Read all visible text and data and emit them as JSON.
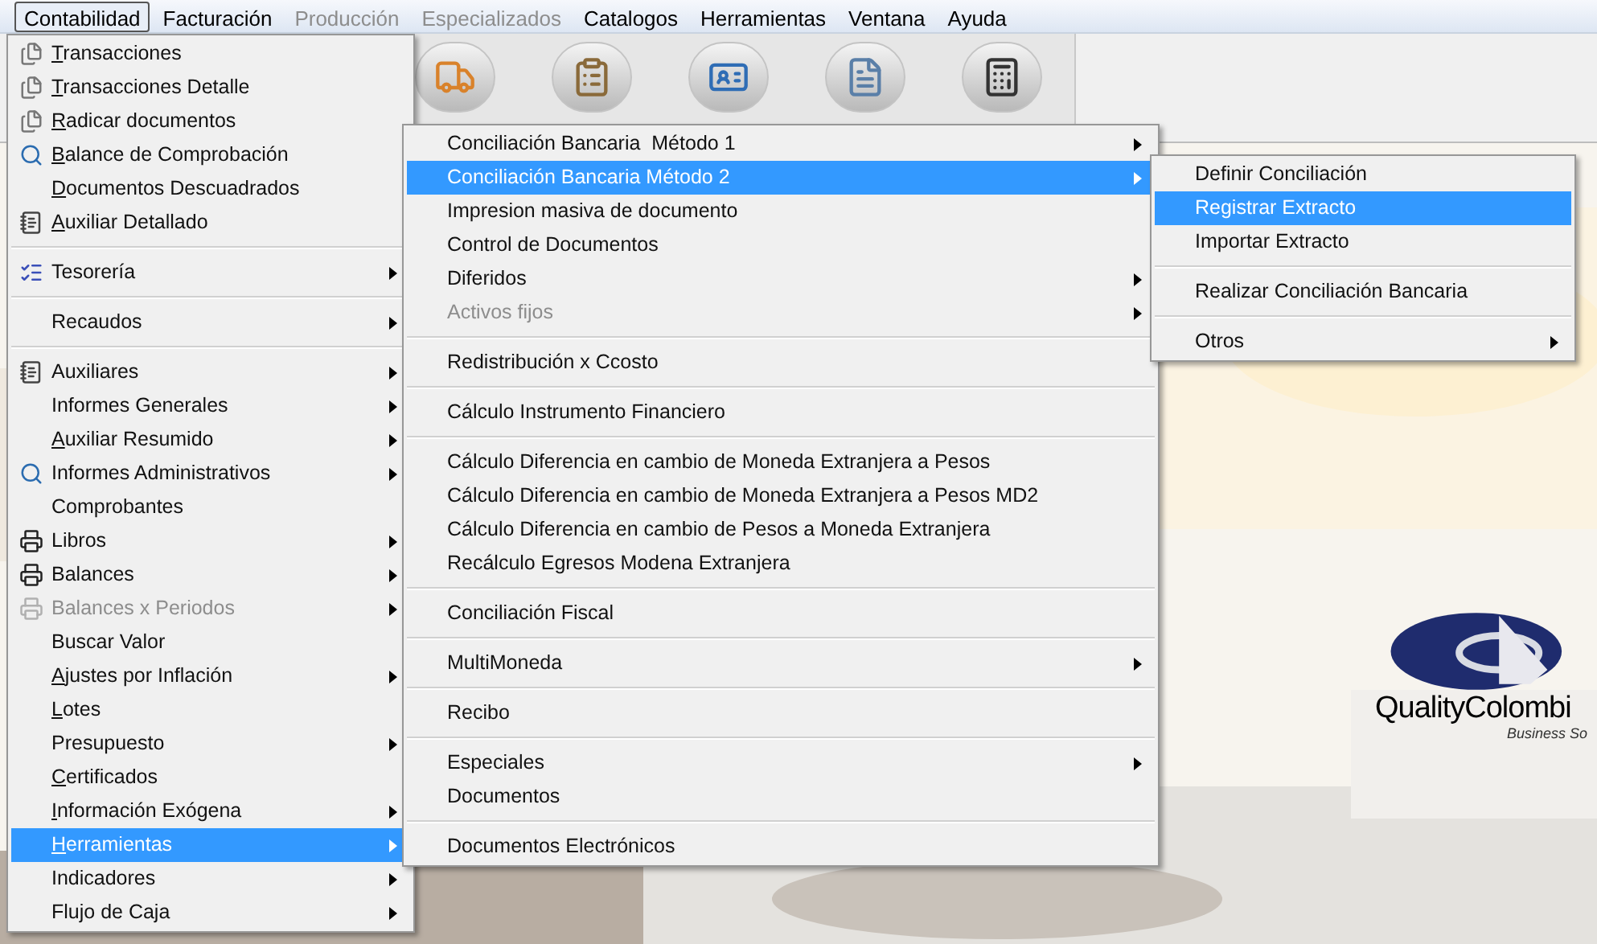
{
  "menubar": [
    {
      "label": "Contabilidad",
      "selected": true,
      "disabled": false
    },
    {
      "label": "Facturación",
      "selected": false,
      "disabled": false
    },
    {
      "label": "Producción",
      "selected": false,
      "disabled": true
    },
    {
      "label": "Especializados",
      "selected": false,
      "disabled": true
    },
    {
      "label": "Catalogos",
      "selected": false,
      "disabled": false
    },
    {
      "label": "Herramientas",
      "selected": false,
      "disabled": false
    },
    {
      "label": "Ventana",
      "selected": false,
      "disabled": false
    },
    {
      "label": "Ayuda",
      "selected": false,
      "disabled": false
    }
  ],
  "toolbar": {
    "buttons": [
      {
        "kind": "truck"
      },
      {
        "kind": "clipboard"
      },
      {
        "kind": "card"
      },
      {
        "kind": "document"
      },
      {
        "kind": "calculator"
      }
    ]
  },
  "contabilidad_menu": {
    "groups": [
      [
        {
          "label": "Transacciones",
          "kind": "ledger",
          "mnemonic": true,
          "submenu": false,
          "disabled": false,
          "selected": false
        },
        {
          "label": "Transacciones Detalle",
          "kind": "ledger",
          "mnemonic": true,
          "submenu": false,
          "disabled": false,
          "selected": false
        },
        {
          "label": "Radicar documentos",
          "kind": "ledger",
          "mnemonic": true,
          "submenu": false,
          "disabled": false,
          "selected": false
        },
        {
          "label": "Balance de Comprobación",
          "kind": "magnifier",
          "mnemonic": true,
          "submenu": false,
          "disabled": false,
          "selected": false
        },
        {
          "label": "Documentos Descuadrados",
          "mnemonic": true,
          "submenu": false,
          "disabled": false,
          "selected": false
        },
        {
          "label": "Auxiliar Detallado",
          "kind": "notebook",
          "mnemonic": true,
          "submenu": false,
          "disabled": false,
          "selected": false
        }
      ],
      [
        {
          "label": "Tesorería",
          "kind": "checklist",
          "mnemonic": false,
          "submenu": true,
          "disabled": false,
          "selected": false
        }
      ],
      [
        {
          "label": "Recaudos",
          "mnemonic": false,
          "submenu": true,
          "disabled": false,
          "selected": false
        }
      ],
      [
        {
          "label": "Auxiliares",
          "kind": "notebook",
          "mnemonic": false,
          "submenu": true,
          "disabled": false,
          "selected": false
        },
        {
          "label": "Informes Generales",
          "mnemonic": false,
          "submenu": true,
          "disabled": false,
          "selected": false
        },
        {
          "label": "Auxiliar Resumido",
          "mnemonic": true,
          "submenu": true,
          "disabled": false,
          "selected": false
        },
        {
          "label": "Informes Administrativos",
          "kind": "magnifier",
          "mnemonic": false,
          "submenu": true,
          "disabled": false,
          "selected": false
        },
        {
          "label": "Comprobantes",
          "mnemonic": false,
          "submenu": false,
          "disabled": false,
          "selected": false
        },
        {
          "label": "Libros",
          "kind": "printer",
          "mnemonic": false,
          "submenu": true,
          "disabled": false,
          "selected": false
        },
        {
          "label": "Balances",
          "kind": "printer",
          "mnemonic": false,
          "submenu": true,
          "disabled": false,
          "selected": false
        },
        {
          "label": "Balances x Periodos",
          "kind": "printer",
          "mnemonic": false,
          "submenu": true,
          "disabled": true,
          "selected": false
        },
        {
          "label": "Buscar Valor",
          "mnemonic": false,
          "submenu": false,
          "disabled": false,
          "selected": false
        },
        {
          "label": "Ajustes por Inflación",
          "mnemonic": true,
          "submenu": true,
          "disabled": false,
          "selected": false
        },
        {
          "label": "Lotes",
          "mnemonic": true,
          "submenu": false,
          "disabled": false,
          "selected": false
        },
        {
          "label": "Presupuesto",
          "mnemonic": false,
          "submenu": true,
          "disabled": false,
          "selected": false
        },
        {
          "label": "Certificados",
          "mnemonic": true,
          "submenu": false,
          "disabled": false,
          "selected": false
        },
        {
          "label": "Información Exógena",
          "mnemonic": true,
          "submenu": true,
          "disabled": false,
          "selected": false
        },
        {
          "label": "Herramientas",
          "mnemonic": true,
          "submenu": true,
          "disabled": false,
          "selected": true
        },
        {
          "label": "Indicadores",
          "mnemonic": false,
          "submenu": true,
          "disabled": false,
          "selected": false
        },
        {
          "label": "Flujo de Caja",
          "mnemonic": false,
          "submenu": true,
          "disabled": false,
          "selected": false
        }
      ]
    ]
  },
  "herramientas_menu": {
    "groups": [
      [
        {
          "label": "Conciliación Bancaria  Método 1",
          "submenu": true,
          "disabled": false,
          "selected": false
        },
        {
          "label": "Conciliación Bancaria Método 2",
          "submenu": true,
          "disabled": false,
          "selected": true
        },
        {
          "label": "Impresion masiva de documento",
          "submenu": false,
          "disabled": false,
          "selected": false
        },
        {
          "label": "Control de Documentos",
          "submenu": false,
          "disabled": false,
          "selected": false
        },
        {
          "label": "Diferidos",
          "submenu": true,
          "disabled": false,
          "selected": false
        },
        {
          "label": "Activos fijos",
          "submenu": true,
          "disabled": true,
          "selected": false
        }
      ],
      [
        {
          "label": "Redistribución x Ccosto",
          "submenu": false,
          "disabled": false,
          "selected": false
        }
      ],
      [
        {
          "label": "Cálculo Instrumento Financiero",
          "submenu": false,
          "disabled": false,
          "selected": false
        }
      ],
      [
        {
          "label": "Cálculo Diferencia en cambio de Moneda Extranjera a Pesos",
          "submenu": false,
          "disabled": false,
          "selected": false
        },
        {
          "label": "Cálculo Diferencia en cambio de Moneda Extranjera a Pesos MD2",
          "submenu": false,
          "disabled": false,
          "selected": false
        },
        {
          "label": "Cálculo Diferencia en cambio de Pesos a Moneda Extranjera",
          "submenu": false,
          "disabled": false,
          "selected": false
        },
        {
          "label": "Recálculo Egresos Modena Extranjera",
          "submenu": false,
          "disabled": false,
          "selected": false
        }
      ],
      [
        {
          "label": "Conciliación Fiscal",
          "submenu": false,
          "disabled": false,
          "selected": false
        }
      ],
      [
        {
          "label": "MultiMoneda",
          "submenu": true,
          "disabled": false,
          "selected": false
        }
      ],
      [
        {
          "label": "Recibo",
          "submenu": false,
          "disabled": false,
          "selected": false
        }
      ],
      [
        {
          "label": "Especiales",
          "submenu": true,
          "disabled": false,
          "selected": false
        },
        {
          "label": "Documentos",
          "submenu": false,
          "disabled": false,
          "selected": false
        }
      ],
      [
        {
          "label": "Documentos Electrónicos",
          "submenu": false,
          "disabled": false,
          "selected": false
        }
      ]
    ]
  },
  "conciliacion_menu": {
    "groups": [
      [
        {
          "label": "Definir Conciliación",
          "submenu": false,
          "disabled": false,
          "selected": false
        },
        {
          "label": "Registrar Extracto",
          "submenu": false,
          "disabled": false,
          "selected": true
        },
        {
          "label": "Importar Extracto",
          "submenu": false,
          "disabled": false,
          "selected": false
        }
      ],
      [
        {
          "label": "Realizar Conciliación Bancaria",
          "submenu": false,
          "disabled": false,
          "selected": false
        }
      ],
      [
        {
          "label": "Otros",
          "submenu": true,
          "disabled": false,
          "selected": false
        }
      ]
    ]
  },
  "logo": {
    "name": "QualityColombi",
    "tagline": "Business So"
  }
}
